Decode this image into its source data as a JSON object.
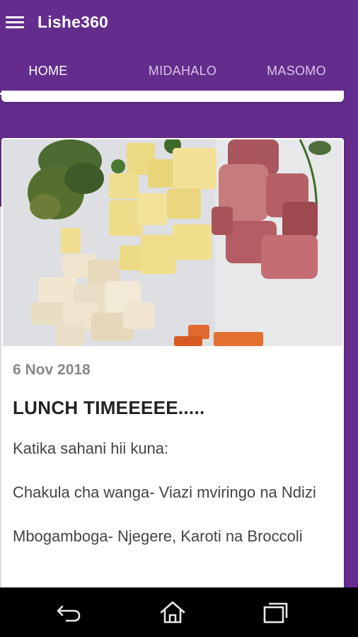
{
  "app": {
    "title": "Lishe360"
  },
  "icons": {
    "menu": "hamburger-menu-icon",
    "back": "back-icon",
    "home": "home-icon",
    "recents": "recent-apps-icon"
  },
  "tabs": [
    {
      "label": "HOME",
      "active": true
    },
    {
      "label": "MIDAHALO",
      "active": false
    },
    {
      "label": "MASOMO",
      "active": false
    }
  ],
  "post": {
    "date": "6 Nov 2018",
    "title": "LUNCH TIMEEEEE.....",
    "paragraphs": [
      "Katika sahani hii kuna:",
      "Chakula cha wanga- Viazi mviringo na Ndizi",
      "Mbogamboga- Njegere, Karoti na Broccoli"
    ]
  },
  "colors": {
    "primary": "#642c8c",
    "tab_inactive": "#d9c6e9",
    "background": "#f1f1f1"
  }
}
